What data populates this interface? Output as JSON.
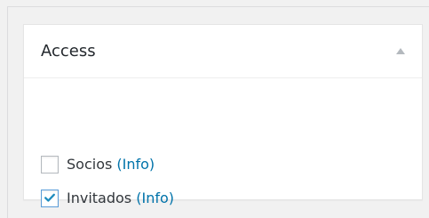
{
  "metabox": {
    "title": "Access",
    "toggle_icon": "triangle-up-icon",
    "options": [
      {
        "label": "Socios",
        "info_label": "(Info)",
        "checked": false
      },
      {
        "label": "Invitados",
        "info_label": "(Info)",
        "checked": true
      }
    ]
  },
  "colors": {
    "background": "#f1f1f1",
    "panel": "#ffffff",
    "title_text": "#23282d",
    "link": "#0073aa",
    "checkbox_border": "#b4b9be",
    "checkbox_focus_border": "#5b9dd9",
    "checkmark": "#1e8cbe"
  }
}
